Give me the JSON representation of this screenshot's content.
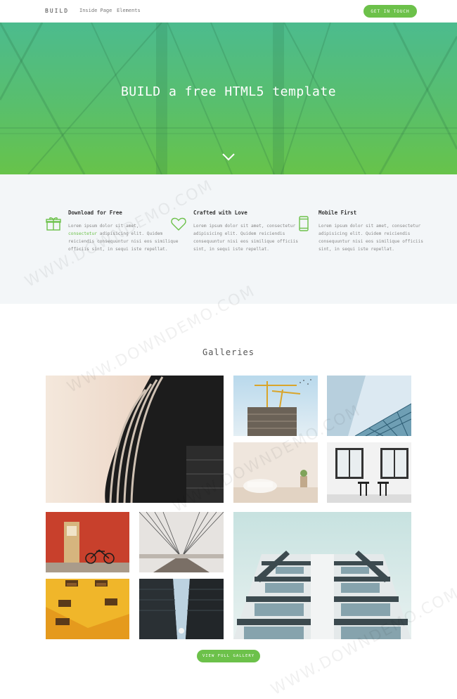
{
  "nav": {
    "brand": "BUILD",
    "links": [
      "Inside Page",
      "Elements"
    ],
    "cta_label": "GET IN TOUCH"
  },
  "hero": {
    "title": "BUILD a free HTML5 template",
    "chevron_icon": "chevron-down-icon"
  },
  "features": [
    {
      "icon": "gift-icon",
      "title": "Download for Free",
      "text_before": "Lorem ipsum dolor sit amet,",
      "text_accent": "consectetur",
      "text_after": "adipisicing elit. Quidem reiciendis consequuntur nisi eos similique officiis sint, in sequi iste repellat."
    },
    {
      "icon": "heart-icon",
      "title": "Crafted with Love",
      "text_before": "Lorem ipsum dolor sit amet, consectetur adipisicing elit. Quidem reiciendis consequuntur nisi eos similique officiis sint, in sequi iste repellat.",
      "text_accent": "",
      "text_after": ""
    },
    {
      "icon": "mobile-icon",
      "title": "Mobile First",
      "text_before": "Lorem ipsum dolor sit amet, consectetur adipisicing elit. Quidem reiciendis consequuntur nisi eos similique officiis sint, in sequi iste repellat.",
      "text_accent": "",
      "text_after": ""
    }
  ],
  "gallery": {
    "title": "Galleries",
    "button_label": "VIEW FULL GALLERY",
    "images": [
      "curved-building-photo",
      "construction-crane-photo",
      "glass-facade-photo",
      "white-interior-photo",
      "window-room-photo",
      "red-wall-bicycle-photo",
      "suspension-bridge-photo",
      "facade-upward-photo",
      "yellow-wall-windows-photo",
      "dark-towers-photo"
    ]
  },
  "watermark": "WWW.DOWNDEMO.COM",
  "colors": {
    "accent": "#6cc14a",
    "hero_top": "#4cbb8e",
    "hero_bottom": "#67c34a",
    "features_bg": "#f3f6f8"
  }
}
